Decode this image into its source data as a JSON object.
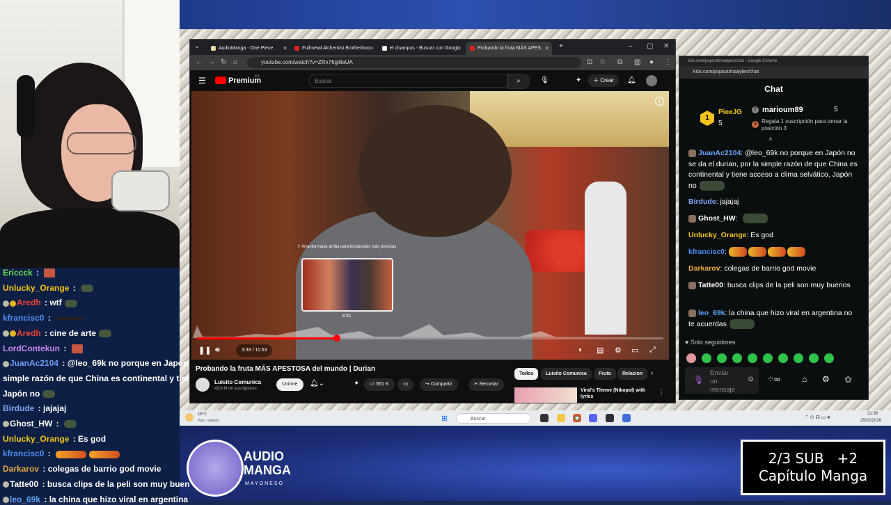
{
  "left_chat": [
    {
      "user": "Ericcck",
      "color": "#6fdc52",
      "badges": [],
      "text": "",
      "emotes": [
        "red"
      ]
    },
    {
      "user": "Unlucky_Orange",
      "color": "#f0c419",
      "badges": [],
      "text": "",
      "emotes": [
        "frog"
      ]
    },
    {
      "user": "Aredh",
      "color": "#e8443a",
      "badges": [
        "grey",
        "gold"
      ],
      "text": "wtf",
      "emotes": [
        "frog"
      ]
    },
    {
      "user": "kfrancisc0",
      "color": "#4f8ef0",
      "badges": [],
      "text": "",
      "emotes": [
        "dark"
      ]
    },
    {
      "user": "Aredh",
      "color": "#e8443a",
      "badges": [
        "grey",
        "gold"
      ],
      "text": "cine de arte",
      "emotes": [
        "frog"
      ]
    },
    {
      "user": "LordContekun",
      "color": "#c888f0",
      "badges": [],
      "text": "",
      "emotes": [
        "red"
      ]
    },
    {
      "user": "JuanAc2104",
      "color": "#6a9ef5",
      "badges": [
        "grey"
      ],
      "text": "@leo_69k no porque en Japón",
      "emotes": []
    },
    {
      "user": "",
      "color": "#fff",
      "badges": [],
      "text": "simple razón de que China es continental y tiene",
      "emotes": []
    },
    {
      "user": "",
      "color": "#fff",
      "badges": [],
      "text": "Japón no",
      "emotes": [
        "frog"
      ]
    },
    {
      "user": "Birdude",
      "color": "#7aa5ef",
      "badges": [],
      "text": "jajajaj",
      "emotes": []
    },
    {
      "user": "Ghost_HW",
      "color": "#fff",
      "badges": [
        "grey"
      ],
      "text": "",
      "emotes": [
        "frog"
      ]
    },
    {
      "user": "Unlucky_Orange",
      "color": "#f0c419",
      "badges": [],
      "text": "Es god",
      "emotes": []
    },
    {
      "user": "kfrancisc0",
      "color": "#4f8ef0",
      "badges": [],
      "text": "",
      "emotes": [
        "fire",
        "fire"
      ]
    },
    {
      "user": "Darkarov",
      "color": "#e7a840",
      "badges": [],
      "text": "colegas de barrio god movie",
      "emotes": []
    },
    {
      "user": "Tatte00",
      "color": "#fff",
      "badges": [
        "grey"
      ],
      "text": "busca clips de la peli son muy buen",
      "emotes": []
    },
    {
      "user": "leo_69k",
      "color": "#5ea0f0",
      "badges": [
        "grey"
      ],
      "text": "la china que hizo viral en argentina",
      "emotes": []
    }
  ],
  "browser": {
    "tabs": [
      {
        "label": "AudioManga - One Piece",
        "fav": "#e7d7a0",
        "active": false
      },
      {
        "label": "Fullmetal Alchemist Brotherhoo",
        "fav": "#e02020",
        "active": false
      },
      {
        "label": "el champus - Buscar con Googl",
        "fav": "#fff",
        "active": false
      },
      {
        "label": "Probando la fruta MÁS APES",
        "fav": "#e02020",
        "active": true
      }
    ],
    "new_tab": "+",
    "url": "youtube.com/watch?v=ZRx76gi8aUA"
  },
  "youtube": {
    "brand": "Premium",
    "brand_sup": "ES",
    "search_placeholder": "Buscar",
    "create_label": "Crear",
    "video": {
      "time": "3:33 / 11:53",
      "preview_hint": "⇧ Arrastra hacia arriba para búsquedas más precisas",
      "preview_time": "3:51",
      "progress": 0.3
    },
    "title": "Probando la fruta MÁS APESTOSA del mundo | Durian",
    "channel": "Luisito Comunica",
    "subscribers": "43,6 M de suscriptores",
    "join_label": "Unirme",
    "likes": "561 K",
    "share_label": "Compartir",
    "clip_label": "Recortar",
    "chips": [
      "Todos",
      "Luisito Comunica",
      "Fruta",
      "Relacion"
    ],
    "rec_title": "Viral's Theme (Nikopol) with lyrics"
  },
  "kick": {
    "window_title": "kick.com/popout/maaylen/chat - Google Chrome",
    "url": "kick.com/popout/maaylen/chat",
    "title": "Chat",
    "leader1": {
      "rank": "1",
      "name": "PieeJG",
      "count": "5"
    },
    "leader2": {
      "rank": "2",
      "name": "marioum89",
      "count": "5"
    },
    "leader3": {
      "rank": "3",
      "text": "Regala 1 suscripción para tomar la posición 3"
    },
    "messages": [
      {
        "user": "JuanAc2104",
        "color": "#6aa0f7",
        "text": "@leo_69k no porque en Japón no se da el durian, por la simple razón de que China es continental y tiene acceso a clima selvático, Japón no"
      },
      {
        "user": "Birdude",
        "color": "#7ba7f2",
        "text": "jajajaj"
      },
      {
        "user": "Ghost_HW",
        "color": "#fff",
        "text": ""
      },
      {
        "user": "Unlucky_Orange",
        "color": "#f2c31a",
        "text": "Es god"
      },
      {
        "user": "kfrancisc0",
        "color": "#4d8df2",
        "text": ""
      },
      {
        "user": "Darkarov",
        "color": "#eea838",
        "text": "colegas de barrio god movie"
      },
      {
        "user": "Tatte00",
        "color": "#fff",
        "text": "busca clips de la peli son muy buenos"
      },
      {
        "user": "leo_69k",
        "color": "#5aa0f2",
        "text": "la china que hizo viral en argentina no te acuerdas"
      }
    ],
    "followers_only": "Solo seguidores",
    "send_placeholder": "Enviar un mensaje"
  },
  "taskbar": {
    "weather_temp": "16°C",
    "weather_desc": "Parc. nublado",
    "search": "Buscar",
    "time": "21:39",
    "date": "25/02/2026"
  },
  "overlay": {
    "logo_line1": "AUDIO",
    "logo_line2": "MANGA",
    "logo_sub": "MAYONESO",
    "sub_line1": "2/3 SUB   +2",
    "sub_line2": "Capítulo Manga"
  }
}
